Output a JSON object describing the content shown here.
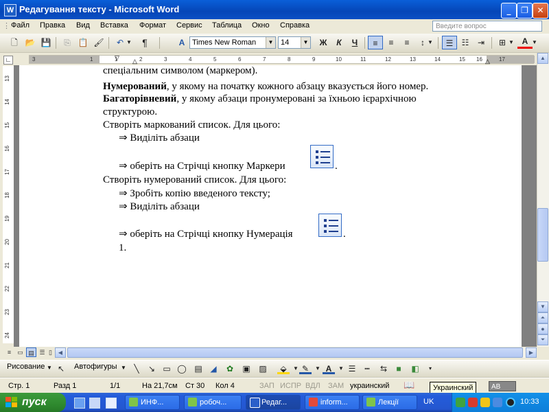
{
  "window": {
    "title": "Редагування тексту - Microsoft Word",
    "app_icon": "W"
  },
  "menu": {
    "items": [
      "Файл",
      "Правка",
      "Вид",
      "Вставка",
      "Формат",
      "Сервис",
      "Таблица",
      "Окно",
      "Справка"
    ],
    "help_placeholder": "Введите вопрос"
  },
  "toolbar": {
    "font_name": "Times New Roman",
    "font_size": "14",
    "bold_label": "Ж",
    "italic_label": "К",
    "underline_label": "Ч",
    "paragraph_glyph": "¶",
    "font_color_label": "A",
    "styles_label": "A"
  },
  "ruler": {
    "marks": [
      "3",
      "1",
      "1",
      "2",
      "3",
      "4",
      "5",
      "6",
      "7",
      "8",
      "9",
      "10",
      "11",
      "12",
      "13",
      "14",
      "15",
      "16",
      "17"
    ],
    "vmarks": [
      "13",
      "14",
      "15",
      "16",
      "17",
      "18",
      "19",
      "20",
      "21",
      "22",
      "23",
      "24"
    ]
  },
  "document": {
    "line1": "спеціальним символом (маркером).",
    "line2_bold": "Нумерований",
    "line2_rest": ", у якому на початку кожного абзацу вказується його номер.",
    "line3_bold": "Багаторівневий",
    "line3_rest": ", у якому абзаци пронумеровані за їхньою ієрархічною",
    "line4": "структурою.",
    "line5": "Створіть маркований список. Для цього:",
    "line6": "⇒ Виділіть  абзаци",
    "line7": "⇒ оберіть на Стрічці кнопку Маркери",
    "line7_end": ".",
    "line8": "Створіть нумерований список. Для цього:",
    "line9": "⇒ Зробіть копію введеного тексту;",
    "line10": "⇒  Виділіть  абзаци",
    "line11": "⇒ оберіть на Стрічці кнопку Нумерація",
    "line11_end": ".",
    "line12": "1."
  },
  "drawing_toolbar": {
    "draw_label": "Рисование",
    "autoshapes_label": "Автофигуры"
  },
  "status": {
    "page": "Стр. 1",
    "section": "Разд 1",
    "pages": "1/1",
    "at": "На 21,7см",
    "line": "Ст 30",
    "col": "Кол 4",
    "rec": "ЗАП",
    "trk": "ИСПР",
    "ext": "ВДЛ",
    "ovr": "ЗАМ",
    "language": "украинский",
    "tooltip": "Украинский",
    "ab_label": "AB"
  },
  "taskbar": {
    "start_label": "пуск",
    "tasks": [
      {
        "label": "ИНФ..."
      },
      {
        "label": "робоч..."
      },
      {
        "label": "Редаг..."
      },
      {
        "label": "inform..."
      },
      {
        "label": "Лекції"
      }
    ],
    "lang": "UK",
    "clock": "10:33"
  }
}
